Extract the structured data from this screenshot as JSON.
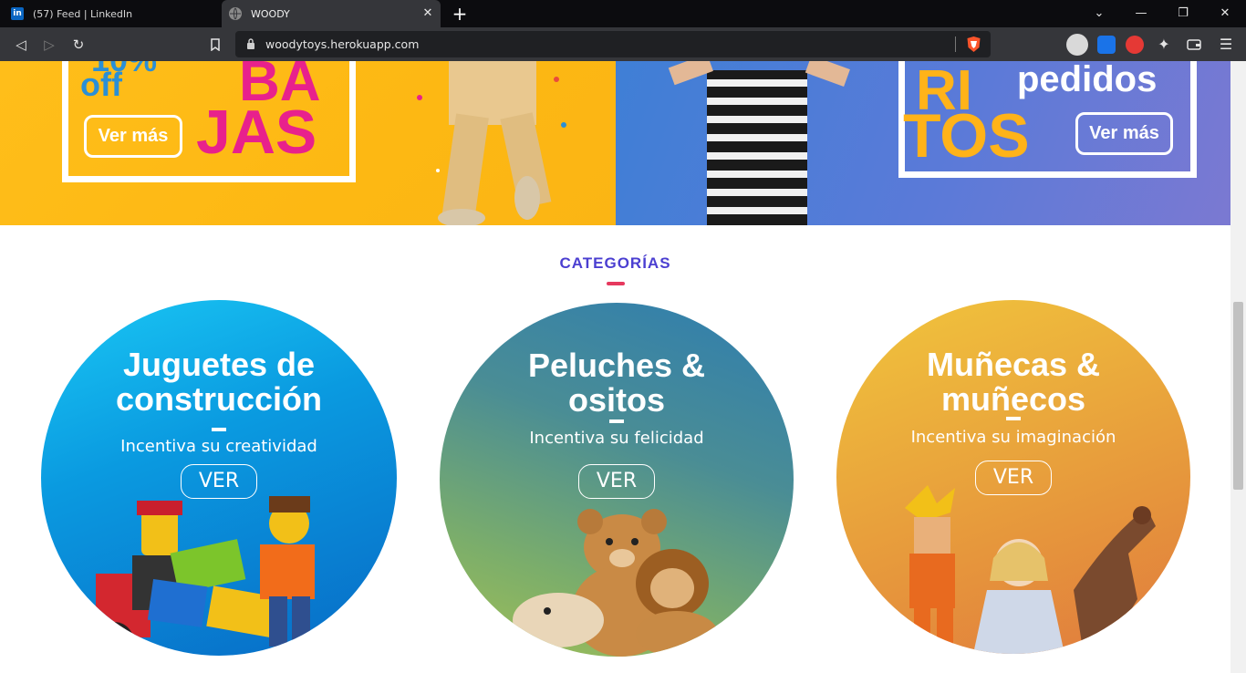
{
  "browser": {
    "tabs": [
      {
        "title": "(57) Feed | LinkedIn",
        "favicon": "in",
        "active": false
      },
      {
        "title": "WOODY",
        "favicon": "",
        "active": true
      }
    ],
    "url": "woodytoys.herokuapp.com"
  },
  "banners": {
    "left": {
      "off_text": "off",
      "pct_text": "10%",
      "big_line1": "BA",
      "big_line2": "JAS",
      "button": "Ver más"
    },
    "right": {
      "line_pedidos": "pedidos",
      "big_line1": "RI",
      "big_line2": "TOS",
      "button": "Ver más"
    }
  },
  "section": {
    "title": "CATEGORÍAS"
  },
  "categories": [
    {
      "title": "Juguetes de construcción",
      "subtitle": "Incentiva su creatividad",
      "button": "VER"
    },
    {
      "title": "Peluches & ositos",
      "subtitle": "Incentiva su felicidad",
      "button": "VER"
    },
    {
      "title": "Muñecas & muñecos",
      "subtitle": "Incentiva su imaginación",
      "button": "VER"
    }
  ],
  "colors": {
    "accent": "#4b3fd1",
    "underline": "#e6395e",
    "banner_left": "#fdb813",
    "banner_right": "#5b7ad8",
    "brand_pink": "#e8218c"
  }
}
